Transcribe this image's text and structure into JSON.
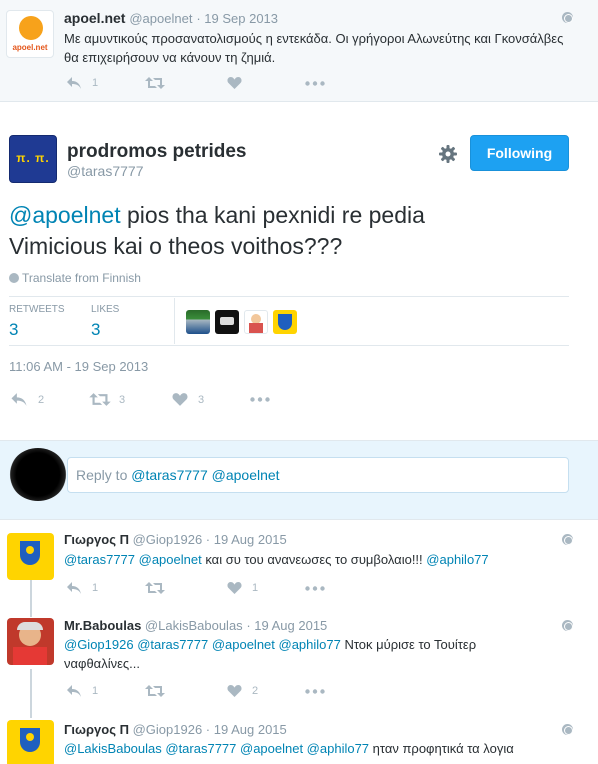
{
  "tweets_above": [
    {
      "name": "apoel.net",
      "handle": "@apoelnet",
      "date": "19 Sep 2013",
      "avatar_text": "apoel.net",
      "text": "Με αμυντικούς προσανατολισμούς η εντεκάδα. Οι γρήγοροι Αλωνεύτης και Γκονσάλβες θα επιχειρήσουν να κάνουν τη ζημιά.",
      "reply_count": "1",
      "retweet_count": "",
      "like_count": ""
    }
  ],
  "main": {
    "name": "prodromos petrides",
    "handle": "@taras7777",
    "avatar_text": "π. π.",
    "follow_label": "Following",
    "mention": "@apoelnet",
    "text": " pios tha kani pexnidi re pedia Vimicious kai o theos voithos???",
    "translate": "Translate from Finnish",
    "stats": {
      "retweets_label": "RETWEETS",
      "retweets": "3",
      "likes_label": "LIKES",
      "likes": "3"
    },
    "timestamp": "11:06 AM - 19 Sep 2013",
    "actions": {
      "reply": "2",
      "retweet": "3",
      "like": "3"
    }
  },
  "reply_box": {
    "prefix": "Reply to ",
    "mentions": "@taras7777 @apoelnet"
  },
  "replies": [
    {
      "name": "Γιωργος Π",
      "handle": "@Giop1926",
      "date": "19 Aug 2015",
      "mentions": "@taras7777 @apoelnet",
      "text": " και συ του ανανεωσες το συμβολαιο!!! ",
      "trail_mention": "@aphilo77",
      "reply_count": "1",
      "retweet_count": "",
      "like_count": "1"
    },
    {
      "name": "Mr.Baboulas",
      "handle": "@LakisBaboulas",
      "date": "19 Aug 2015",
      "mentions": "@Giop1926 @taras7777 @apoelnet @aphilo77",
      "text": " Ντοκ μύρισε το Τουίτερ ναφθαλίνες...",
      "reply_count": "1",
      "retweet_count": "",
      "like_count": "2"
    },
    {
      "name": "Γιωργος Π",
      "handle": "@Giop1926",
      "date": "19 Aug 2015",
      "mentions": "@LakisBaboulas @taras7777 @apoelnet @aphilo77",
      "text": " ηταν προφητικά τα λογια"
    }
  ],
  "icons": [
    "reply-icon",
    "retweet-icon",
    "like-icon",
    "more-icon",
    "gear-icon",
    "globe-icon"
  ],
  "colors": {
    "accent": "#1da1f2",
    "link": "#0084b4",
    "muted": "#8899a6",
    "icon": "#aab8c2"
  }
}
